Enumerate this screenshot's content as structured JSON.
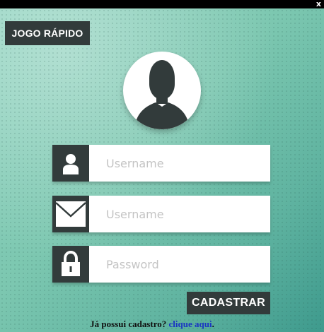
{
  "window": {
    "close_glyph": "x"
  },
  "quick_play": {
    "label": "JOGO RÁPIDO"
  },
  "avatar": {
    "icon": "user-silhouette-icon"
  },
  "fields": {
    "username": {
      "placeholder": "Username",
      "value": "",
      "icon": "user-icon"
    },
    "email": {
      "placeholder": "Username",
      "value": "",
      "icon": "envelope-icon"
    },
    "password": {
      "placeholder": "Password",
      "value": "",
      "icon": "lock-icon"
    }
  },
  "register": {
    "label": "CADASTRAR"
  },
  "login_prompt": {
    "text": "Já possui cadastro? ",
    "link": "clique aqui",
    "suffix": "."
  },
  "colors": {
    "dark": "#323b3b",
    "link": "#1a35c2",
    "background": "#7fc9b3"
  }
}
